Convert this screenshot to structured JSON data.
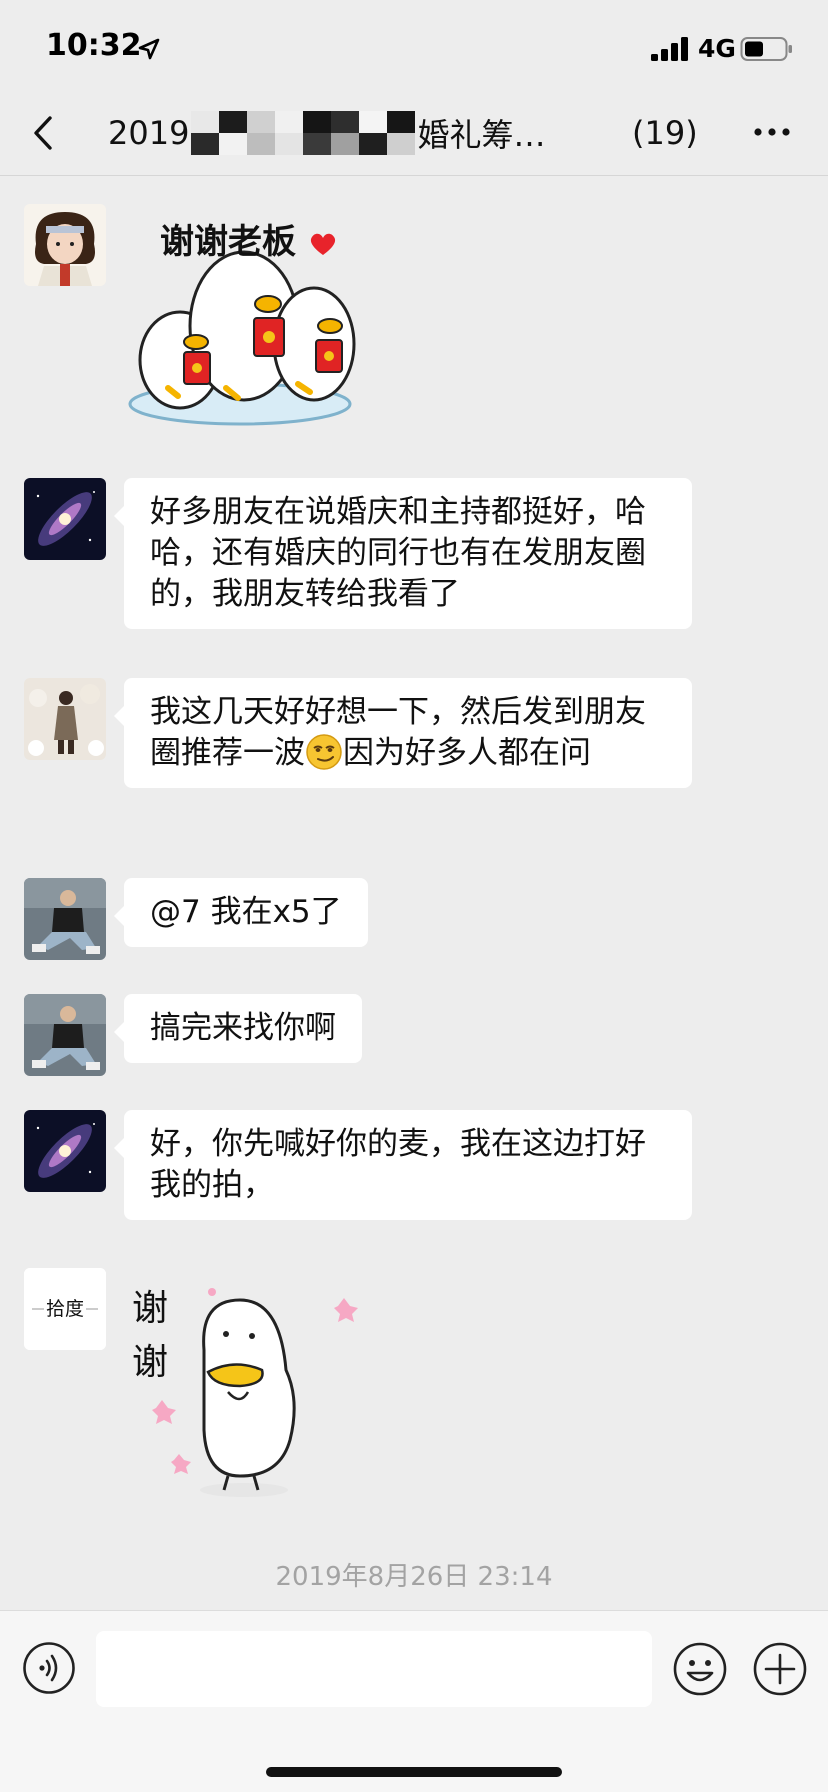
{
  "status_bar": {
    "time": "10:32",
    "network": "4G",
    "icons": [
      "location-arrow-icon",
      "signal-bars-icon",
      "battery-icon"
    ]
  },
  "nav": {
    "title_prefix": "2019",
    "title_suffix": "婚礼筹…",
    "member_count": "(19)",
    "icons": [
      "back-chevron-icon",
      "more-dots-icon"
    ]
  },
  "messages": [
    {
      "type": "sticker",
      "avatar": "avatar-cartoon-person",
      "sticker": "three-ducks-red-envelope",
      "caption": "谢谢老板"
    },
    {
      "type": "text",
      "avatar": "avatar-galaxy",
      "text": "好多朋友在说婚庆和主持都挺好，哈哈，还有婚庆的同行也有在发朋友圈的，我朋友转给我看了"
    },
    {
      "type": "text",
      "avatar": "avatar-woman-photo",
      "text_before": "我这几天好好想一下，然后发到朋友圈推荐一波",
      "emoji": "smirk-emoji-icon",
      "text_after": "因为好多人都在问"
    },
    {
      "type": "text",
      "avatar": "avatar-man-sitting",
      "text": "@7 我在x5了"
    },
    {
      "type": "text",
      "avatar": "avatar-man-sitting",
      "text": "搞完来找你啊"
    },
    {
      "type": "text",
      "avatar": "avatar-galaxy",
      "text": "好，你先喊好你的麦，我在这边打好我的拍，"
    },
    {
      "type": "sticker",
      "avatar": "avatar-brand-logo",
      "sticker": "duck-thank-you-flowers",
      "caption_line1": "谢",
      "caption_line2": "谢",
      "avatar_text": "拾度"
    }
  ],
  "timestamp": "2019年8月26日 23:14",
  "input_bar": {
    "placeholder": "",
    "icons": [
      "voice-icon",
      "emoji-icon",
      "plus-icon"
    ]
  },
  "colors": {
    "background": "#ededed",
    "bubble": "#ffffff",
    "timestamp": "#a3a3a3",
    "input_bar": "#f6f6f6"
  }
}
